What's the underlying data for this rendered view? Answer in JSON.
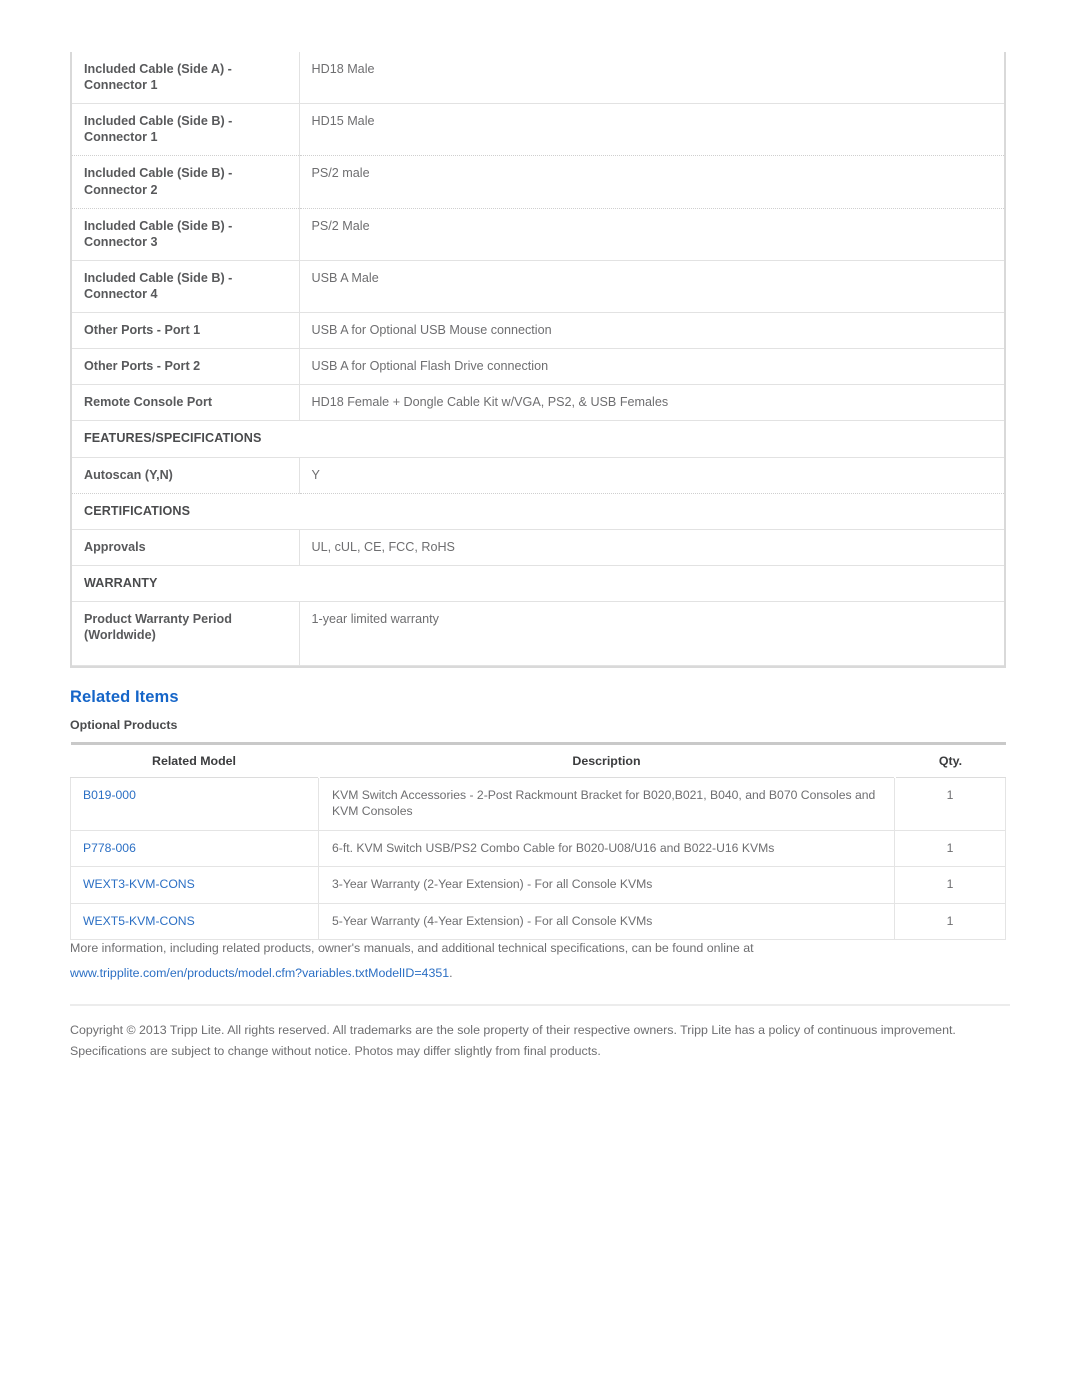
{
  "spec_table": {
    "rows": [
      {
        "kind": "pair",
        "sep": "solid",
        "label": "Included Cable (Side A) - Connector 1",
        "value": "HD18 Male"
      },
      {
        "kind": "pair",
        "sep": "dotted",
        "label": "Included Cable (Side B) - Connector 1",
        "value": "HD15 Male"
      },
      {
        "kind": "pair",
        "sep": "dotted",
        "label": "Included Cable (Side B) - Connector 2",
        "value": "PS/2 male"
      },
      {
        "kind": "pair",
        "sep": "solid",
        "label": "Included Cable (Side B) - Connector 3",
        "value": "PS/2 Male"
      },
      {
        "kind": "pair",
        "sep": "solid",
        "label": "Included Cable (Side B) - Connector 4",
        "value": "USB A Male"
      },
      {
        "kind": "pair",
        "sep": "solid",
        "label": "Other Ports - Port 1",
        "value": "USB A for Optional USB Mouse connection"
      },
      {
        "kind": "pair",
        "sep": "solid",
        "label": "Other Ports - Port 2",
        "value": "USB A for Optional Flash Drive connection"
      },
      {
        "kind": "pair",
        "sep": "solid",
        "label": "Remote Console Port",
        "value": "HD18 Female + Dongle Cable Kit w/VGA, PS2, & USB Females"
      },
      {
        "kind": "section",
        "label": "FEATURES/SPECIFICATIONS"
      },
      {
        "kind": "pair",
        "sep": "dotted",
        "label": "Autoscan (Y,N)",
        "value": "Y"
      },
      {
        "kind": "section",
        "label": "CERTIFICATIONS"
      },
      {
        "kind": "pair",
        "sep": "solid",
        "label": "Approvals",
        "value": "UL, cUL, CE, FCC, RoHS"
      },
      {
        "kind": "section",
        "label": "WARRANTY"
      },
      {
        "kind": "pair",
        "sep": "solid",
        "label": "Product Warranty Period (Worldwide)",
        "value": "1-year limited warranty",
        "tall": true
      }
    ]
  },
  "related": {
    "heading": "Related Items",
    "subheading": "Optional Products",
    "columns": {
      "model": "Related Model",
      "description": "Description",
      "qty": "Qty."
    },
    "rows": [
      {
        "model": "B019-000",
        "description": "KVM Switch Accessories - 2-Post Rackmount Bracket for B020,B021, B040, and B070 Consoles and KVM Consoles",
        "qty": "1"
      },
      {
        "model": "P778-006",
        "description": "6-ft. KVM Switch USB/PS2 Combo Cable for B020-U08/U16 and B022-U16 KVMs",
        "qty": "1"
      },
      {
        "model": "WEXT3-KVM-CONS",
        "description": "3-Year Warranty (2-Year Extension) - For all Console KVMs",
        "qty": "1"
      },
      {
        "model": "WEXT5-KVM-CONS",
        "description": "5-Year Warranty (4-Year Extension) - For all Console KVMs",
        "qty": "1"
      }
    ]
  },
  "footer": {
    "more_info_text": "More information, including related products, owner's manuals, and additional technical specifications, can be found online at",
    "url": "www.tripplite.com/en/products/model.cfm?variables.txtModelID=4351",
    "url_period": ".",
    "copyright": "Copyright © 2013 Tripp Lite. All rights reserved. All trademarks are the sole property of their respective owners. Tripp Lite has a policy of continuous improvement. Specifications are subject to change without notice. Photos may differ slightly from final products."
  },
  "colors": {
    "link": "#2b6fc4",
    "heading": "#1565c8",
    "label_text": "#58595b",
    "value_text": "#6e6e70",
    "border": "#e2e2e2"
  }
}
